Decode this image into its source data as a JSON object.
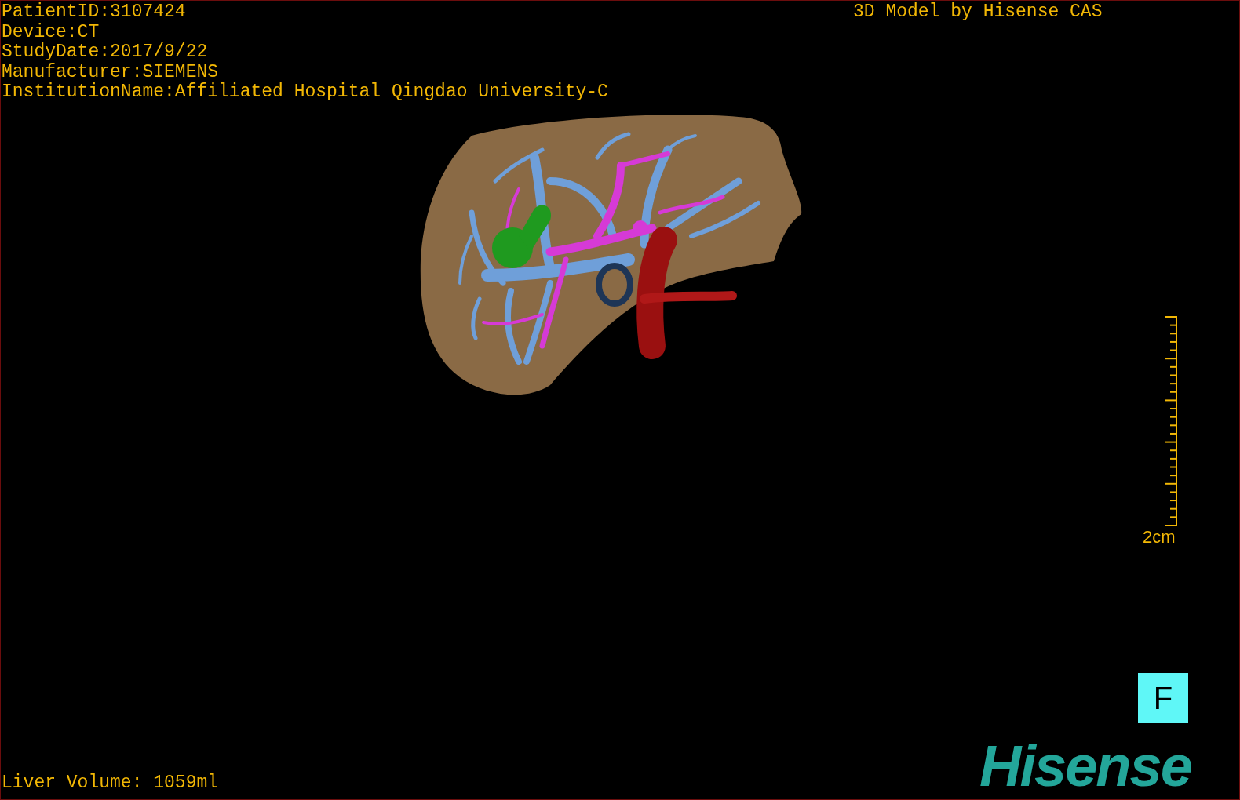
{
  "study_info": [
    "PatientID:3107424",
    "Device:CT",
    "StudyDate:2017/9/22",
    "Manufacturer:SIEMENS",
    "InstitutionName:Affiliated Hospital Qingdao University-C"
  ],
  "model_title": "3D Model by Hisense CAS",
  "scale_bar": {
    "label": "2cm"
  },
  "orientation_marker": "F",
  "liver_volume": "Liver Volume: 1059ml",
  "logo": "Hisense"
}
